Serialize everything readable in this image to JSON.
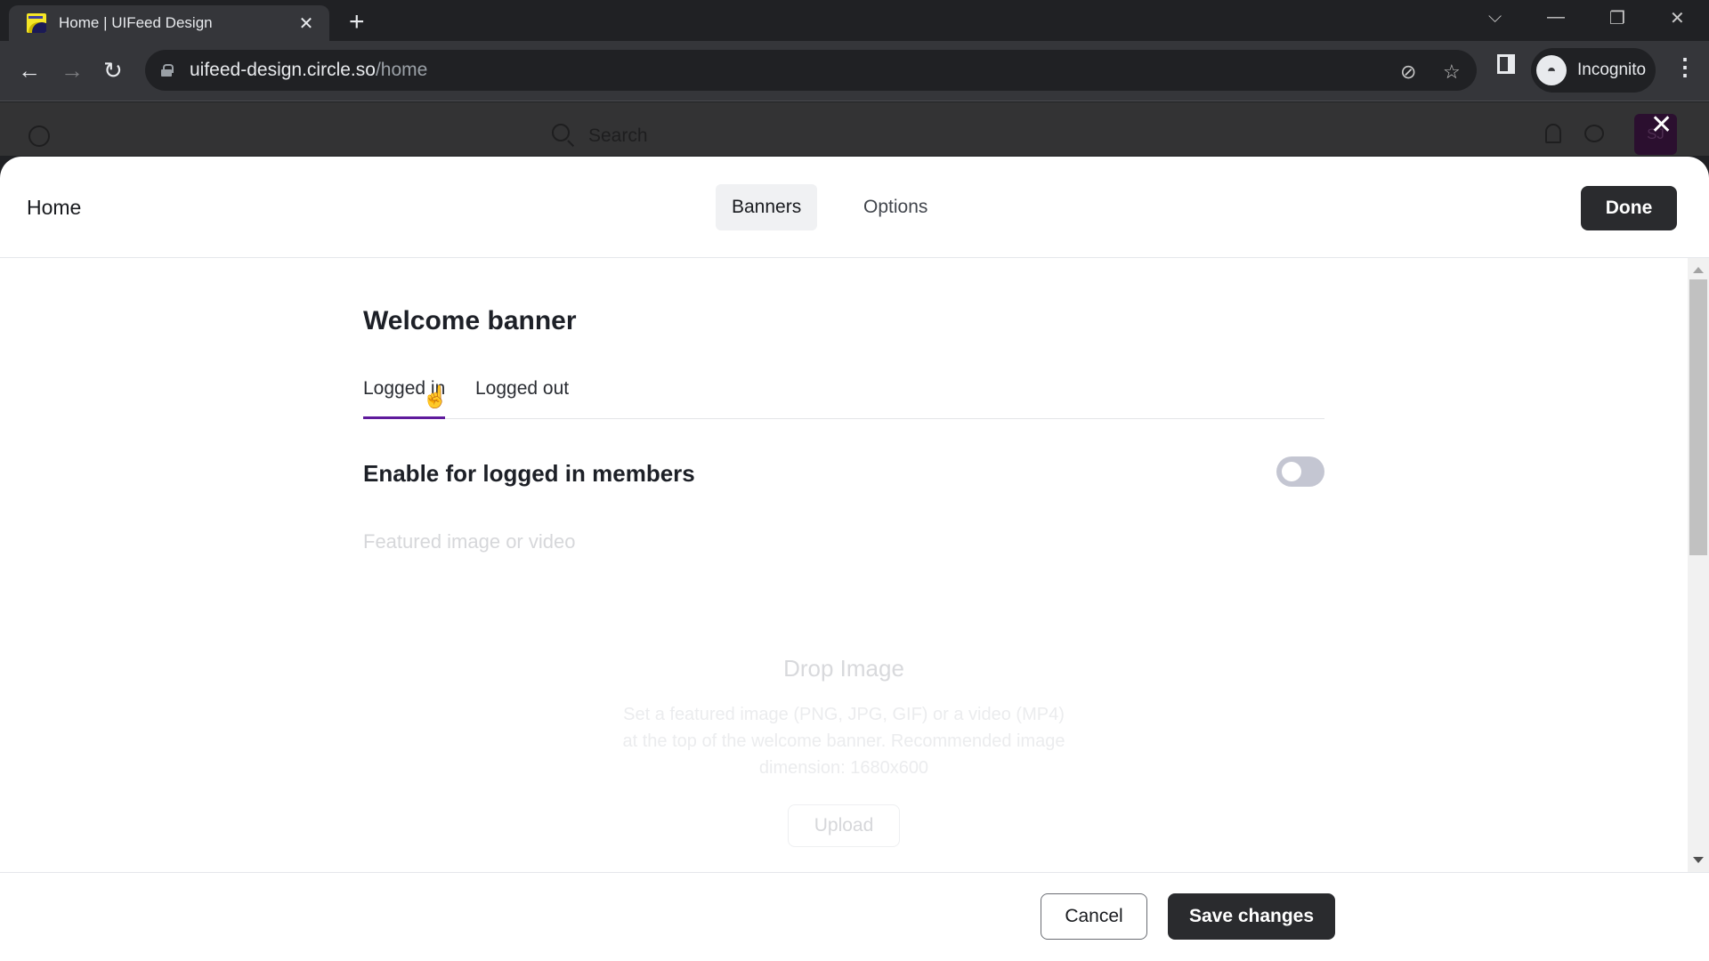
{
  "browser": {
    "tab_title": "Home | UIFeed Design",
    "url_host": "uifeed-design.circle.so",
    "url_path": "/home",
    "profile_label": "Incognito"
  },
  "app_header": {
    "search_placeholder": "Search",
    "avatar_initials": "SJ"
  },
  "modal": {
    "title": "Home",
    "segments": [
      {
        "label": "Banners",
        "active": true
      },
      {
        "label": "Options",
        "active": false
      }
    ],
    "done_label": "Done",
    "section_title": "Welcome banner",
    "tabs": [
      {
        "label": "Logged in",
        "active": true
      },
      {
        "label": "Logged out",
        "active": false
      }
    ],
    "enable_label": "Enable for logged in members",
    "enable_toggle_on": false,
    "featured_label": "Featured image or video",
    "drop_title": "Drop Image",
    "drop_description": "Set a featured image (PNG, JPG, GIF) or a video (MP4) at the top of the welcome banner. Recommended image dimension: 1680x600",
    "upload_label": "Upload",
    "cancel_label": "Cancel",
    "save_label": "Save changes"
  },
  "colors": {
    "accent": "#5f1a9c",
    "primary_button": "#2a2b2e",
    "toggle_off": "#c4c6d2"
  }
}
